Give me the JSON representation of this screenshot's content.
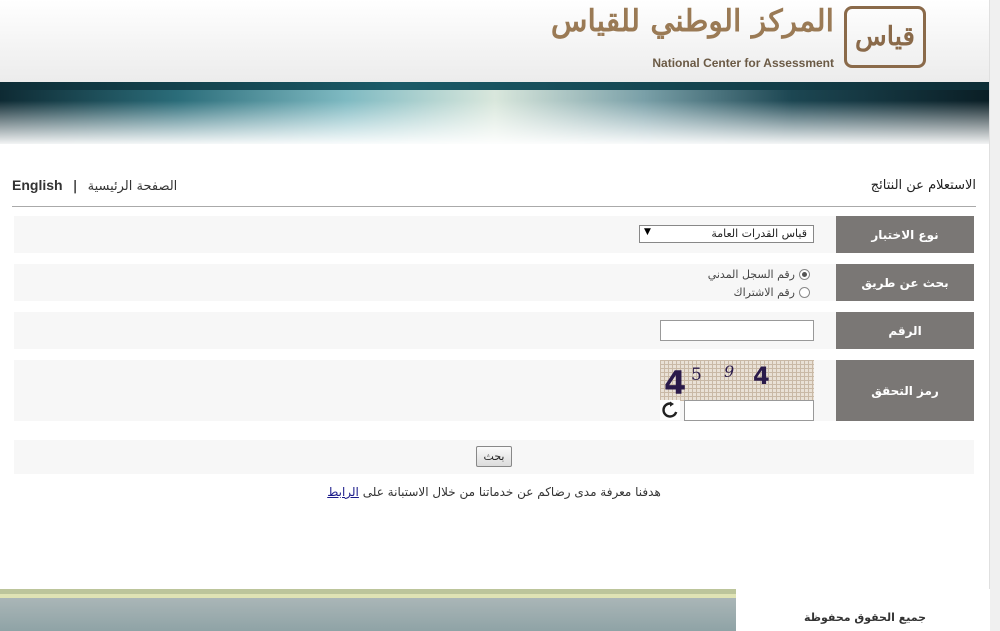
{
  "header": {
    "logo_ar": "المركز الوطني للقياس",
    "logo_mark": "قياس",
    "logo_en": "National Center for Assessment"
  },
  "page": {
    "title": "الاستعلام عن النتائج",
    "english_link": "English",
    "separator": "|",
    "home_link": "الصفحة الرئيسية"
  },
  "form": {
    "test_type": {
      "label": "نوع الاختبار",
      "selected": "قياس القدرات العامة"
    },
    "search_by": {
      "label": "بحث عن طريق",
      "options": [
        {
          "label": "رقم السجل المدني",
          "checked": true
        },
        {
          "label": "رقم الاشتراك",
          "checked": false
        }
      ]
    },
    "number": {
      "label": "الرقم",
      "value": ""
    },
    "captcha": {
      "label": "رمز التحقق",
      "digits": [
        "4",
        "5",
        "9",
        "4"
      ],
      "value": ""
    },
    "submit_label": "بحث"
  },
  "survey": {
    "text": "هدفنا معرفة مدى رضاكم عن خدماتنا من خلال الاستبانة على ",
    "link_label": "الرابط"
  },
  "footer": {
    "copyright": "جميع الحقوق محفوظة"
  },
  "icons": {
    "refresh": "refresh-icon",
    "dropdown": "triangle-down-icon"
  }
}
